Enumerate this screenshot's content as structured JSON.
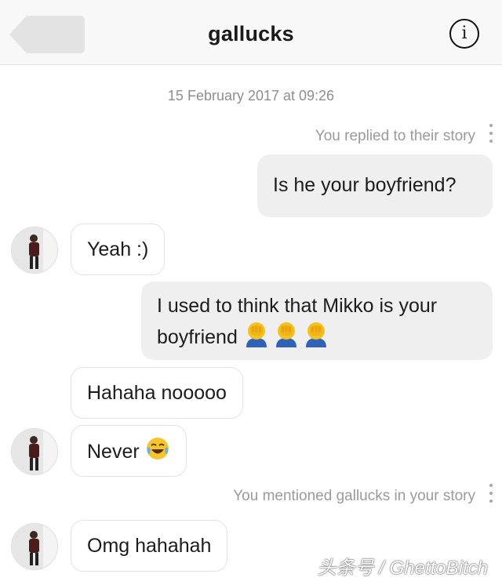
{
  "header": {
    "title": "gallucks",
    "back_icon": "back-arrow-icon",
    "info_icon": "info-icon",
    "info_glyph": "i"
  },
  "timestamp": "15 February 2017 at 09:26",
  "messages": [
    {
      "type": "system",
      "text": "You replied to their story"
    },
    {
      "type": "outgoing",
      "text": "Is he your boyfriend?"
    },
    {
      "type": "incoming",
      "text": "Yeah :)"
    },
    {
      "type": "outgoing",
      "line1": "I used to think that Mikko is your",
      "line2": "boyfriend",
      "emoji": "face-palm-emoji"
    },
    {
      "type": "incoming",
      "text": "Hahaha nooooo"
    },
    {
      "type": "incoming",
      "text": "Never",
      "emoji": "tears-of-joy-emoji"
    },
    {
      "type": "system",
      "text": "You mentioned gallucks in your story"
    },
    {
      "type": "incoming",
      "text": "Omg hahahah"
    }
  ],
  "watermark": "头条号 / GhettoBitch",
  "colors": {
    "header_bg": "#f8f8f8",
    "outgoing_bubble": "#efefef",
    "incoming_border": "#e3e3e3",
    "meta_text": "#8e8e8e"
  }
}
